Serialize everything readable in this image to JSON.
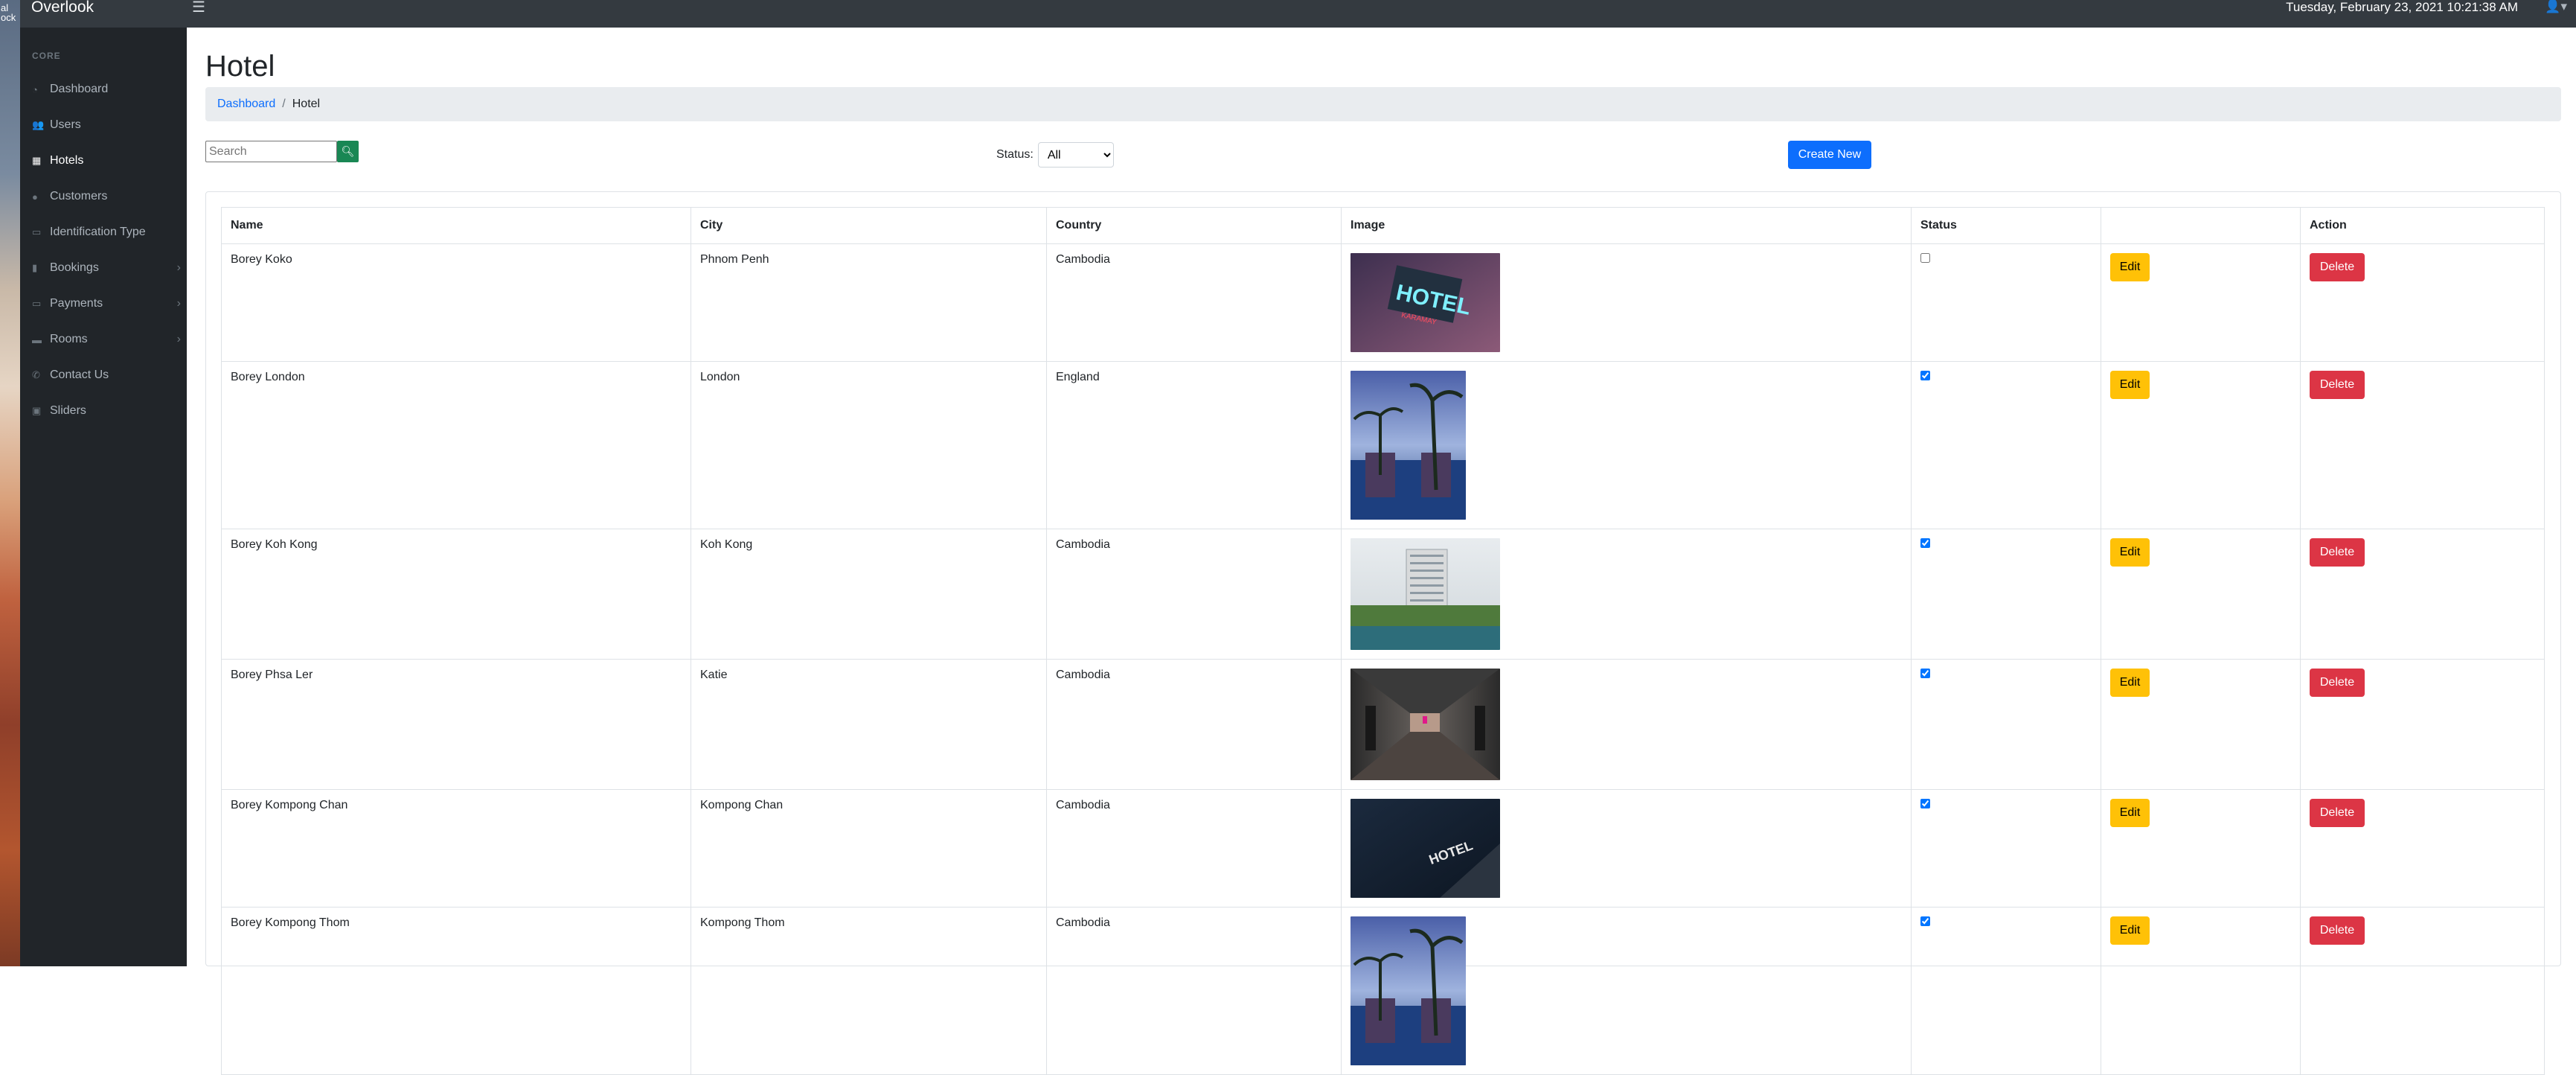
{
  "desktop": {
    "strip_text": "al\nlock"
  },
  "topbar": {
    "brand": "Overlook",
    "menu_icon": "hamburger-icon",
    "datetime": "Tuesday, February 23, 2021 10:21:38 AM",
    "user_icon": "user-icon"
  },
  "sidebar": {
    "heading": "CORE",
    "items": [
      {
        "label": "Dashboard",
        "icon": "tachometer-icon",
        "glyph": "◔",
        "active": false,
        "expandable": false
      },
      {
        "label": "Users",
        "icon": "users-icon",
        "glyph": "👥",
        "active": false,
        "expandable": false
      },
      {
        "label": "Hotels",
        "icon": "hotel-icon",
        "glyph": "▦",
        "active": true,
        "expandable": false
      },
      {
        "label": "Customers",
        "icon": "user-icon",
        "glyph": "●",
        "active": false,
        "expandable": false
      },
      {
        "label": "Identification Type",
        "icon": "id-card-icon",
        "glyph": "▭",
        "active": false,
        "expandable": false
      },
      {
        "label": "Bookings",
        "icon": "bookmark-icon",
        "glyph": "▮",
        "active": false,
        "expandable": true
      },
      {
        "label": "Payments",
        "icon": "money-icon",
        "glyph": "▭",
        "active": false,
        "expandable": true
      },
      {
        "label": "Rooms",
        "icon": "bed-icon",
        "glyph": "▬",
        "active": false,
        "expandable": true
      },
      {
        "label": "Contact Us",
        "icon": "phone-icon",
        "glyph": "✆",
        "active": false,
        "expandable": false
      },
      {
        "label": "Sliders",
        "icon": "images-icon",
        "glyph": "▣",
        "active": false,
        "expandable": false
      }
    ]
  },
  "page": {
    "title": "Hotel",
    "breadcrumb": {
      "home": "Dashboard",
      "separator": "/",
      "current": "Hotel"
    },
    "search": {
      "placeholder": "Search",
      "value": ""
    },
    "status_filter": {
      "label": "Status:",
      "selected": "All"
    },
    "create_button": "Create New"
  },
  "table": {
    "headers": {
      "name": "Name",
      "city": "City",
      "country": "Country",
      "image": "Image",
      "status": "Status",
      "edit_col": "",
      "action": "Action"
    },
    "edit_label": "Edit",
    "delete_label": "Delete",
    "rows": [
      {
        "name": "Borey Koko",
        "city": "Phnom Penh",
        "country": "Cambodia",
        "status": false,
        "image": "hotel-neon-sign"
      },
      {
        "name": "Borey London",
        "city": "London",
        "country": "England",
        "status": true,
        "image": "pool-palm-trees"
      },
      {
        "name": "Borey Koh Kong",
        "city": "Koh Kong",
        "country": "Cambodia",
        "status": true,
        "image": "hotel-tower-pool"
      },
      {
        "name": "Borey Phsa Ler",
        "city": "Katie",
        "country": "Cambodia",
        "status": true,
        "image": "hotel-corridor"
      },
      {
        "name": "Borey Kompong Chan",
        "city": "Kompong Chan",
        "country": "Cambodia",
        "status": true,
        "image": "hotel-night-sign"
      },
      {
        "name": "Borey Kompong Thom",
        "city": "Kompong Thom",
        "country": "Cambodia",
        "status": true,
        "image": "pool-palm-trees"
      }
    ]
  },
  "colors": {
    "topbar": "#343a40",
    "sidebar": "#212529",
    "primary": "#0d6efd",
    "success": "#198754",
    "warning": "#ffc107",
    "danger": "#dc3545"
  }
}
